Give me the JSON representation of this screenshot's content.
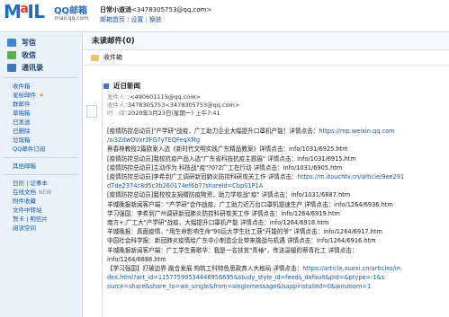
{
  "header": {
    "logo_text": "MAIL",
    "logo_cn": "QQ邮箱",
    "logo_domain": "mail.qq.com",
    "account_label": "日常小道消",
    "account_addr": "<3478305753@qq.com>",
    "links": [
      "邮箱首页",
      "设置",
      "换肤"
    ]
  },
  "sidebar": {
    "actions": [
      "写信",
      "收信",
      "通讯录"
    ],
    "folders": [
      "收件箱",
      "星标邮件",
      "群邮件",
      "草稿箱",
      "已发送",
      "已删除",
      "垃圾箱",
      "QQ邮件订阅"
    ],
    "other": [
      "其他邮箱"
    ],
    "tools": [
      "日历 | 记事本",
      "在线文档",
      "附件收藏",
      "文件中转站",
      "贺卡 | 明信片",
      "阅读空间"
    ],
    "new_badge": "NEW"
  },
  "main": {
    "title": "未读邮件(0)",
    "folder_label": "收件箱",
    "subject": "近日新闻",
    "meta": {
      "from_k": "发件人：",
      "from_v": ";<490601115@qq.com>",
      "to_k": "收件人：",
      "to_v": "3478305753<3478305753@qq.com>",
      "time_k": "时　间：",
      "time_v": "2020年3月23日(星期一) 上午7:41"
    },
    "lines": [
      {
        "t": "[疫情防控总动员]\"产学研\"战疫，广工助力企业大幅提升口罩机产能！详情点击：",
        "u": "https://mp.weixin.qq.com"
      },
      {
        "t": "",
        "u": "/s/3ZdwOVxr2FG7yTEQFeqXMg"
      },
      {
        "t": "蔡春林教授2篇欧案入选《新时代文明实践广东精品教案》详情点击：info/1031/6925.htm",
        "u": ""
      },
      {
        "t": "[疫情防控总动员]我校抗疫产品入选\"广东省科技抗疫主题展\" 详情点击：info/1031/6915.htm",
        "u": ""
      },
      {
        "t": "[疫情防控总动员]主动作为 科技战\"疫\"?0?2广工在行动 详情点击：info/1031/6905.htm",
        "u": ""
      },
      {
        "t": "[疫情防控总动员]李希到广工调研新冠肺炎防控科研攻关工作 详情点击：",
        "u": "https://m.itouchtv.cn/article/9ee291"
      },
      {
        "t": "",
        "u": "d7de2374c8d5c3b260174ef6b7?shareId=CbpS1P1A"
      },
      {
        "t": "[疫情防控总动员]我校校友捐赠防疫物资，助力学校战\"疫\" 详情点击：info/1031/6887.htm",
        "u": ""
      },
      {
        "t": "羊城晚报新闻客户端：\"产学研\"合作战疫，广工助力近万台口罩机提速生产 详情点击：info/1264/6936.htm",
        "u": ""
      },
      {
        "t": "学习强国：李希到广州调研新冠肺炎防控科研攻关工作 详情点击：info/1264/6919.htm",
        "u": ""
      },
      {
        "t": "南方+:广工大\"产学研\"战疫，大幅提升口罩机产能 详情点击：info/1264/6918.htm",
        "u": ""
      },
      {
        "t": "羊城晚报：真面疫情，\"用生命影响生命\"90后大学生社工获\"开能的爷\" 详情点击：info/1264/6917.htm",
        "u": ""
      },
      {
        "t": "中国社会科学报：新冠肺炎疫情给广东中小制造企业带来挑战与机遇 详情点击：info/1264/6916.htm",
        "u": ""
      },
      {
        "t": "羊城晚报新闻客户端：广工学生黄歌华：我是一名扶贫\"青椿\"，传送温暖的蔡青社工 详情点击：",
        "u": ""
      },
      {
        "t": "info/1264/6886.htm",
        "u": ""
      },
      {
        "t": "【学习强国】打破边界 融合发展 构筑工科特色思政育人大格局 详情点击：",
        "u": "https://article.xuexi.cn/articles/in"
      },
      {
        "t": "",
        "u": "dex.html?art_id=11577599534446956695&study_style_id=feeds_default&pid=&ptype=-1&s"
      },
      {
        "t": "",
        "u": "ource=share&share_to=wx_single&from=singlemessage&isappinstalled=0&winzoom=1"
      }
    ]
  }
}
